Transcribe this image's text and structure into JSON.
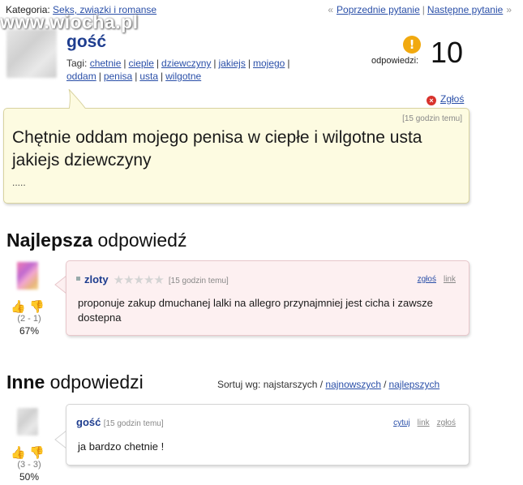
{
  "topbar": {
    "category_label": "Kategoria:",
    "category_link": "Seks, związki i romanse",
    "prev_prefix": "«",
    "prev_label": "Poprzednie pytanie",
    "next_label": "Następne pytanie",
    "next_suffix": "»",
    "watermark": "www.wiocha.pl"
  },
  "question": {
    "author": "gość",
    "tags_label": "Tagi:",
    "tags": [
      "chetnie",
      "cieple",
      "dziewczyny",
      "jakiejs",
      "mojego",
      "oddam",
      "penisa",
      "usta",
      "wilgotne"
    ],
    "answers_icon": "!",
    "answers_label": "odpowiedzi:",
    "answers_count": "10",
    "report_label": "Zgłoś",
    "report_icon": "×",
    "time": "[15 godzin temu]",
    "text": "Chętnie oddam mojego penisa w ciepłe i wilgotne usta jakiejs dziewczyny",
    "more": "....."
  },
  "best": {
    "heading_bold": "Najlepsza",
    "heading_rest": " odpowiedź",
    "author": "zloty",
    "stars": "★★★★★",
    "time": "[15 godzin temu]",
    "report_label": "zgłoś",
    "link_label": "link",
    "text": "proponuje zakup dmuchanej lalki na allegro przynajmniej jest cicha i zawsze dostepna",
    "thumbs": "👍👎",
    "votes": "(2 - 1)",
    "percent": "67%"
  },
  "others": {
    "heading_bold": "Inne",
    "heading_rest": " odpowiedzi",
    "sort_label": "Sortuj wg: najstarszych /",
    "sort_newest": "najnowszych",
    "sort_sep": "/",
    "sort_best": "najlepszych",
    "answers": [
      {
        "author": "gość",
        "time": "[15 godzin temu]",
        "quote_label": "cytuj",
        "link_label": "link",
        "report_label": "zgłoś",
        "text": "ja bardzo chetnie !",
        "thumbs": "👍👎",
        "votes": "(3 - 3)",
        "percent": "50%"
      }
    ]
  },
  "colors": {
    "link": "#2a4fa8",
    "author": "#1e3d8f",
    "question_bg": "#fdfbe1",
    "best_bg": "#fdf0f1",
    "badge": "#f1a90f",
    "report_icon": "#d8322c"
  }
}
